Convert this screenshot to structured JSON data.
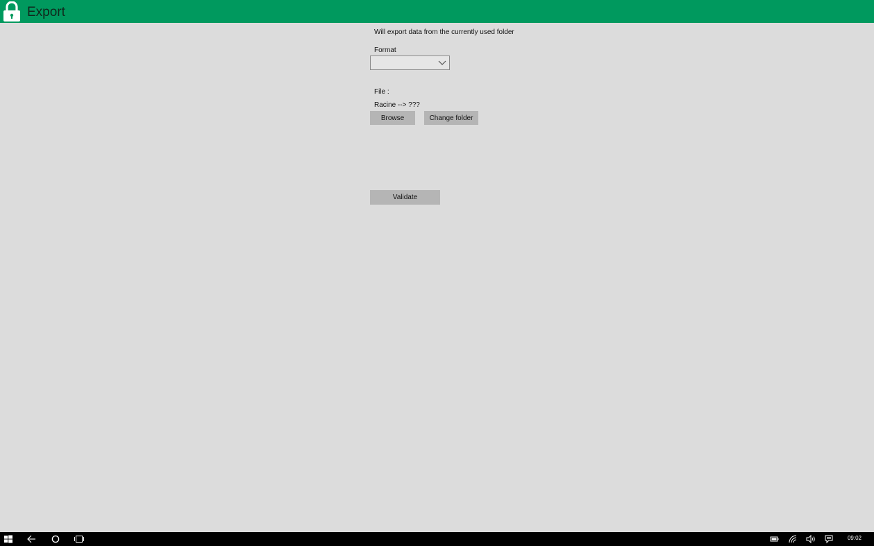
{
  "window": {
    "title": "Export",
    "accent_color": "#00995e"
  },
  "export_form": {
    "intro_text": "Will export data from the currently used folder",
    "format_label": "Format",
    "format_selected": "",
    "file_label": "File :",
    "path_text": "Racine --> ???",
    "browse_label": "Browse",
    "change_folder_label": "Change folder",
    "validate_label": "Validate"
  },
  "taskbar": {
    "icons": [
      "windows-start-icon",
      "back-arrow-icon",
      "cortana-circle-icon",
      "task-view-icon",
      "battery-icon",
      "wifi-icon",
      "volume-icon",
      "notifications-icon"
    ],
    "clock": "09:02"
  }
}
